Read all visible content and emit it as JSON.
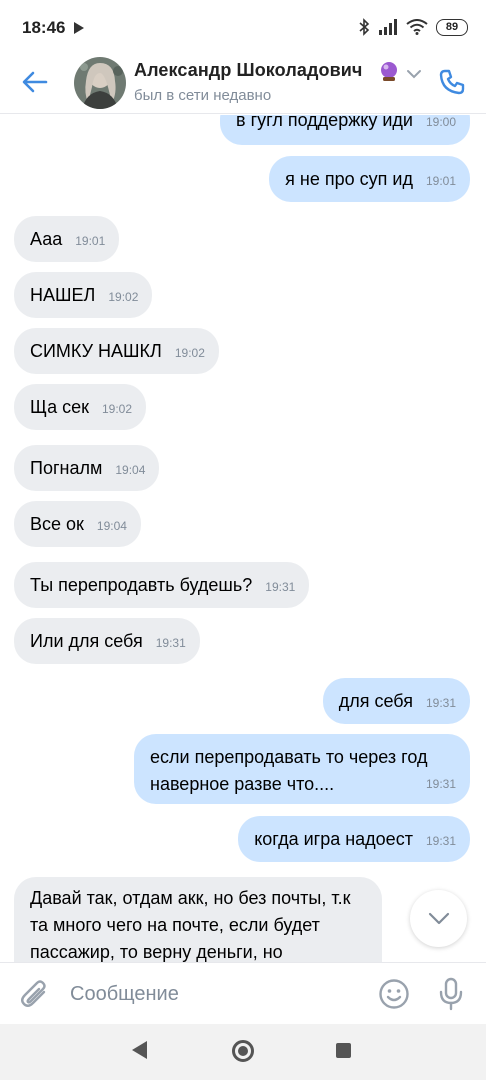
{
  "status_bar": {
    "time": "18:46",
    "battery": "89",
    "icons": [
      "play-icon",
      "bluetooth-icon",
      "signal-icon",
      "wifi-icon",
      "battery-icon"
    ]
  },
  "header": {
    "contact_name": "Александр Шоколадович",
    "contact_status": "был в сети недавно",
    "icons": [
      "back-arrow-icon",
      "avatar",
      "crystal-ball-emoji",
      "chevron-down-icon",
      "phone-icon"
    ],
    "accent_color": "#3f8ae0"
  },
  "messages": [
    {
      "dir": "out",
      "text": "в гугл поддержку иди",
      "time": "19:00"
    },
    {
      "dir": "out",
      "text": "я не про суп ид",
      "time": "19:01"
    },
    {
      "dir": "in",
      "text": "Ааа",
      "time": "19:01"
    },
    {
      "dir": "in",
      "text": "НАШЕЛ",
      "time": "19:02"
    },
    {
      "dir": "in",
      "text": "СИМКУ НАШКЛ",
      "time": "19:02"
    },
    {
      "dir": "in",
      "text": "Ща сек",
      "time": "19:02"
    },
    {
      "dir": "in",
      "text": "Погналм",
      "time": "19:04"
    },
    {
      "dir": "in",
      "text": "Все ок",
      "time": "19:04"
    },
    {
      "dir": "in",
      "text": "Ты перепродавть будешь?",
      "time": "19:31"
    },
    {
      "dir": "in",
      "text": "Или для себя",
      "time": "19:31"
    },
    {
      "dir": "out",
      "text": "для себя",
      "time": "19:31"
    },
    {
      "dir": "out",
      "text": "если перепродавать то через год наверное разве что....",
      "time": "19:31"
    },
    {
      "dir": "out",
      "text": "когда игра надоест",
      "time": "19:31"
    },
    {
      "dir": "in",
      "text": "Давай так, отдам акк, но без почты, т.к та много чего на почте, если будет пассажир, то верну деньги, но",
      "time": ""
    }
  ],
  "composer": {
    "placeholder": "Сообщение",
    "icons": [
      "paperclip-icon",
      "smile-icon",
      "microphone-icon"
    ]
  },
  "scroll_button": {
    "icon": "chevron-down-icon"
  },
  "nav_bar": {
    "icons": [
      "nav-back-icon",
      "nav-home-icon",
      "nav-recents-icon"
    ]
  },
  "colors": {
    "incoming_bubble": "#ebedf0",
    "outgoing_bubble": "#cce4ff",
    "time_text": "#818c99"
  }
}
